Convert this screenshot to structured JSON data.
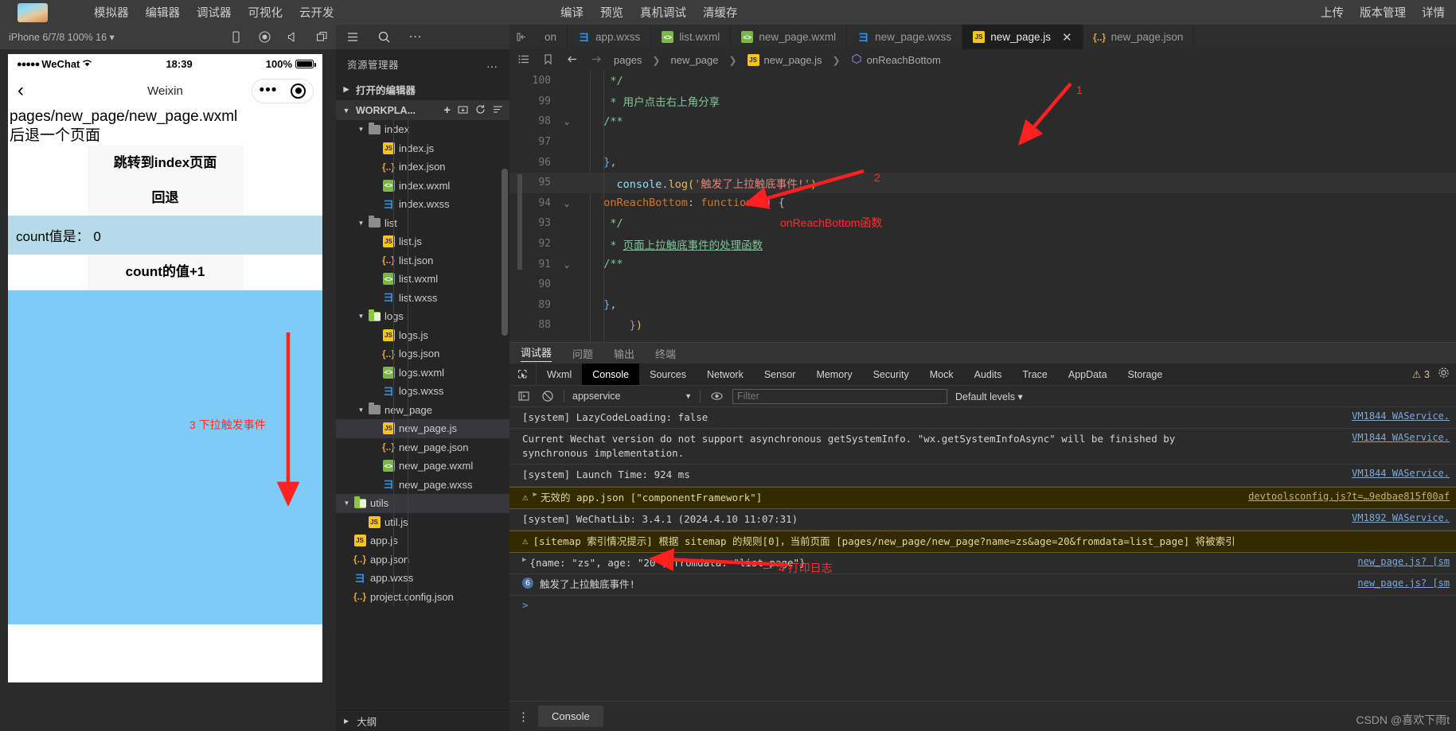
{
  "topbar": {
    "left_menu": [
      "模拟器",
      "编辑器",
      "调试器",
      "可视化",
      "云开发"
    ],
    "center_menu": [
      "编译",
      "预览",
      "真机调试",
      "清缓存"
    ],
    "right_menu": [
      "上传",
      "版本管理",
      "详情"
    ]
  },
  "simulator_toolbar": {
    "device": "iPhone 6/7/8 100% 16 ▾",
    "icons": [
      "phone-icon",
      "record-icon",
      "sound-icon",
      "multi-window-icon"
    ]
  },
  "explorer_toolbar": {
    "icons": [
      "list-icon",
      "search-icon",
      "more-icon"
    ]
  },
  "editor_tabs": [
    {
      "label": "on",
      "icon": "",
      "active": false,
      "partial": true
    },
    {
      "label": "app.wxss",
      "icon": "wxss",
      "active": false
    },
    {
      "label": "list.wxml",
      "icon": "wxml",
      "active": false
    },
    {
      "label": "new_page.wxml",
      "icon": "wxml",
      "active": false
    },
    {
      "label": "new_page.wxss",
      "icon": "wxss",
      "active": false
    },
    {
      "label": "new_page.js",
      "icon": "js",
      "active": true,
      "closable": true
    },
    {
      "label": "new_page.json",
      "icon": "json",
      "active": false
    }
  ],
  "phone": {
    "status": {
      "carrier": "WeChat",
      "time": "18:39",
      "battery": "100%"
    },
    "nav": {
      "title": "Weixin",
      "back_icon": "chevron-left-icon"
    },
    "content": {
      "path_text": "pages/new_page/new_page.wxml",
      "sub_text": "后退一个页面",
      "button_jump": "跳转到index页面",
      "button_back": "回退",
      "count_label": "count值是：",
      "count_value": "0",
      "button_increment": "count的值+1"
    }
  },
  "explorer": {
    "title": "资源管理器",
    "open_editors": "打开的编辑器",
    "workspace": "WORKPLA...",
    "outline": "大纲",
    "tree": [
      {
        "name": "index",
        "type": "folder",
        "indent": 1,
        "expanded": true
      },
      {
        "name": "index.js",
        "type": "js",
        "indent": 2
      },
      {
        "name": "index.json",
        "type": "json",
        "indent": 2
      },
      {
        "name": "index.wxml",
        "type": "wxml",
        "indent": 2
      },
      {
        "name": "index.wxss",
        "type": "wxss",
        "indent": 2
      },
      {
        "name": "list",
        "type": "folder",
        "indent": 1,
        "expanded": true
      },
      {
        "name": "list.js",
        "type": "js",
        "indent": 2
      },
      {
        "name": "list.json",
        "type": "json",
        "indent": 2
      },
      {
        "name": "list.wxml",
        "type": "wxml",
        "indent": 2
      },
      {
        "name": "list.wxss",
        "type": "wxss",
        "indent": 2
      },
      {
        "name": "logs",
        "type": "folder-green",
        "indent": 1,
        "expanded": true
      },
      {
        "name": "logs.js",
        "type": "js",
        "indent": 2
      },
      {
        "name": "logs.json",
        "type": "json",
        "indent": 2
      },
      {
        "name": "logs.wxml",
        "type": "wxml",
        "indent": 2
      },
      {
        "name": "logs.wxss",
        "type": "wxss",
        "indent": 2
      },
      {
        "name": "new_page",
        "type": "folder",
        "indent": 1,
        "expanded": true
      },
      {
        "name": "new_page.js",
        "type": "js",
        "indent": 2,
        "selected": true
      },
      {
        "name": "new_page.json",
        "type": "json",
        "indent": 2
      },
      {
        "name": "new_page.wxml",
        "type": "wxml",
        "indent": 2
      },
      {
        "name": "new_page.wxss",
        "type": "wxss",
        "indent": 2
      },
      {
        "name": "utils",
        "type": "folder-green",
        "indent": 0,
        "expanded": true,
        "highlight": true
      },
      {
        "name": "util.js",
        "type": "js",
        "indent": 1
      },
      {
        "name": "app.js",
        "type": "js",
        "indent": 0
      },
      {
        "name": "app.json",
        "type": "json",
        "indent": 0
      },
      {
        "name": "app.wxss",
        "type": "wxss",
        "indent": 0
      },
      {
        "name": "project.config.json",
        "type": "json",
        "indent": 0
      }
    ]
  },
  "breadcrumb": {
    "parts": [
      "pages",
      "new_page",
      "new_page.js",
      "onReachBottom"
    ]
  },
  "code_lines": [
    {
      "num": "88",
      "fold": "",
      "html": "      <span class='c-br1'>}</span><span class='c-br2'>)</span>"
    },
    {
      "num": "89",
      "fold": "",
      "html": "  <span class='c-blue'>}</span><span class='c-punc'>,</span>"
    },
    {
      "num": "90",
      "fold": "",
      "html": ""
    },
    {
      "num": "91",
      "fold": "⌄",
      "html": "  <span class='c-com'>/**</span>"
    },
    {
      "num": "92",
      "fold": "",
      "html": "   <span class='c-com'>* </span><span class='c-com' style='text-decoration:underline'>页面上拉触底事件的处理函数</span>"
    },
    {
      "num": "93",
      "fold": "",
      "html": "   <span class='c-com'>*/</span>"
    },
    {
      "num": "94",
      "fold": "⌄",
      "html": "  <span class='c-key'>onReachBottom</span><span class='c-punc'>: </span><span class='c-key'>function</span> <span class='c-br1'>()</span> <span class='c-punc'>{</span>"
    },
    {
      "num": "95",
      "fold": "",
      "highlight": true,
      "html": "    <span class='c-obj'>console</span><span class='c-punc'>.</span><span class='c-fn'>log</span><span class='c-br2'>(</span><span class='c-str'>'触发了上拉触底事件!'</span><span class='c-br2'>)</span>"
    },
    {
      "num": "96",
      "fold": "",
      "html": "  <span class='c-blue'>}</span><span class='c-punc'>,</span>"
    },
    {
      "num": "97",
      "fold": "",
      "html": ""
    },
    {
      "num": "98",
      "fold": "⌄",
      "html": "  <span class='c-com'>/**</span>"
    },
    {
      "num": "99",
      "fold": "",
      "html": "   <span class='c-com'>* 用户点击右上角分享</span>"
    },
    {
      "num": "100",
      "fold": "",
      "html": "   <span class='c-com'>*/</span>"
    }
  ],
  "devtools": {
    "panel_tabs": [
      "调试器",
      "问题",
      "输出",
      "终端"
    ],
    "panel_tab_active": "调试器",
    "tabs": [
      "Wxml",
      "Console",
      "Sources",
      "Network",
      "Sensor",
      "Memory",
      "Security",
      "Mock",
      "Audits",
      "Trace",
      "AppData",
      "Storage"
    ],
    "active_tab": "Console",
    "warning_count": "3",
    "filter_bar": {
      "context": "appservice",
      "filter_placeholder": "Filter",
      "levels": "Default levels ▾"
    },
    "messages": [
      {
        "type": "normal",
        "text": "[system] LazyCodeLoading: false",
        "src": "VM1844 WAService."
      },
      {
        "type": "normal",
        "text": "Current Wechat version do not support asynchronous getSystemInfo. \"wx.getSystemInfoAsync\" will be finished by\nsynchronous implementation.",
        "src": "VM1844 WAService."
      },
      {
        "type": "normal",
        "text": "[system] Launch Time: 924 ms",
        "src": "VM1844 WAService."
      },
      {
        "type": "warn",
        "text": "无效的 app.json [\"componentFramework\"]",
        "src": "devtoolsconfig.js?t=…9edbae815f00af",
        "expandable": true
      },
      {
        "type": "normal",
        "text": "[system] WeChatLib: 3.4.1 (2024.4.10 11:07:31)",
        "src": "VM1892 WAService."
      },
      {
        "type": "warn",
        "text": "[sitemap 索引情况提示] 根据 sitemap 的规则[0]，当前页面 [pages/new_page/new_page?name=zs&age=20&fromdata=list_page] 将被索引",
        "src": ""
      },
      {
        "type": "normal",
        "text": "{name: \"zs\", age: \"20\", fromdata: \"list_page\"}",
        "src": "new_page.js? [sm",
        "expandable": true
      },
      {
        "type": "badge",
        "badge": "6",
        "text": "触发了上拉触底事件!",
        "src": "new_page.js? [sm"
      }
    ],
    "footer_tab": "Console"
  },
  "annotations": [
    {
      "id": "1",
      "label": "1"
    },
    {
      "id": "2",
      "label": "2"
    },
    {
      "id": "2b",
      "label": "onReachBottom函数"
    },
    {
      "id": "3",
      "label": "3  下拉触发事件"
    },
    {
      "id": "4",
      "label": "4  打印日志"
    }
  ],
  "watermark": "CSDN @喜欢下雨t"
}
